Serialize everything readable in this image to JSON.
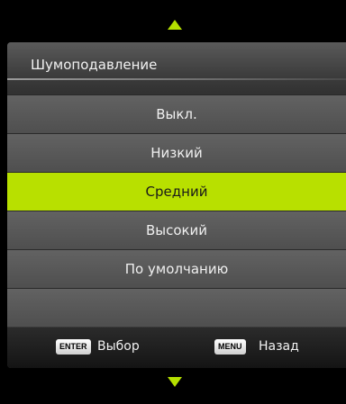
{
  "menu": {
    "title": "Шумоподавление",
    "options": [
      {
        "label": "Выкл.",
        "selected": false
      },
      {
        "label": "Низкий",
        "selected": false
      },
      {
        "label": "Средний",
        "selected": true
      },
      {
        "label": "Высокий",
        "selected": false
      },
      {
        "label": "По умолчанию",
        "selected": false
      }
    ]
  },
  "footer": {
    "enter_key": "ENTER",
    "enter_label": "Выбор",
    "menu_key": "MENU",
    "menu_label": "Назад"
  },
  "colors": {
    "accent": "#b8e000",
    "background": "#000000"
  },
  "icons": {
    "up": "triangle-up-icon",
    "down": "triangle-down-icon"
  }
}
